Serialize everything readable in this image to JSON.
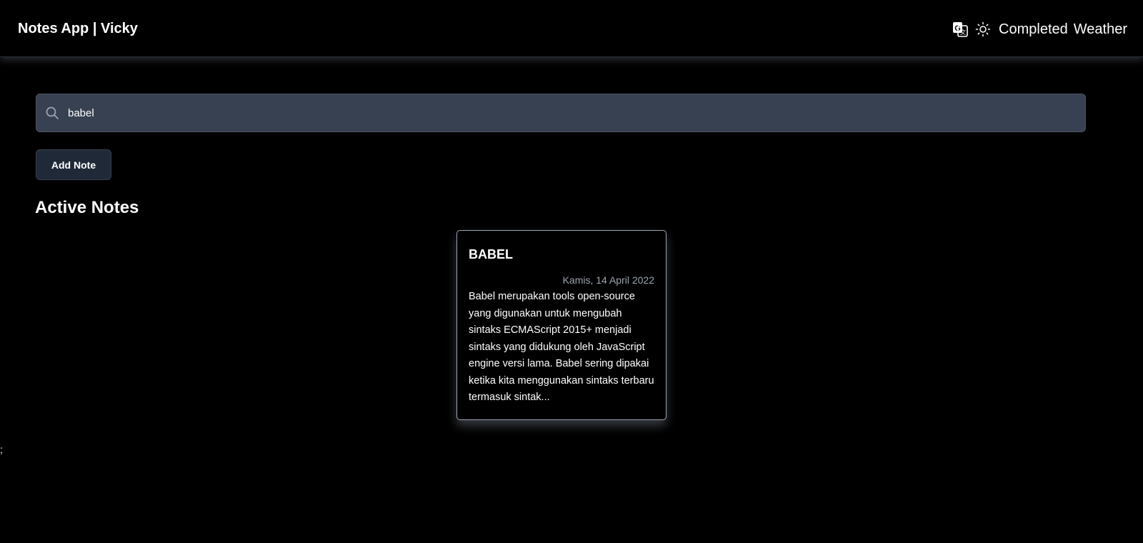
{
  "header": {
    "title": "Notes App | Vicky",
    "translate_icon": "translate-icon",
    "theme_icon": "sun-icon",
    "links": [
      "Completed",
      "Weather"
    ]
  },
  "search": {
    "value": "babel",
    "icon": "search-icon"
  },
  "actions": {
    "add_note_label": "Add Note"
  },
  "sections": {
    "active_title": "Active Notes"
  },
  "notes": [
    {
      "title": "BABEL",
      "date": "Kamis, 14 April 2022",
      "body": "Babel merupakan tools open-source yang digunakan untuk mengubah sintaks ECMAScript 2015+ menjadi sintaks yang didukung oleh JavaScript engine versi lama. Babel sering dipakai ketika kita menggunakan sintaks terbaru termasuk sintak..."
    }
  ],
  "stray_text": ";"
}
